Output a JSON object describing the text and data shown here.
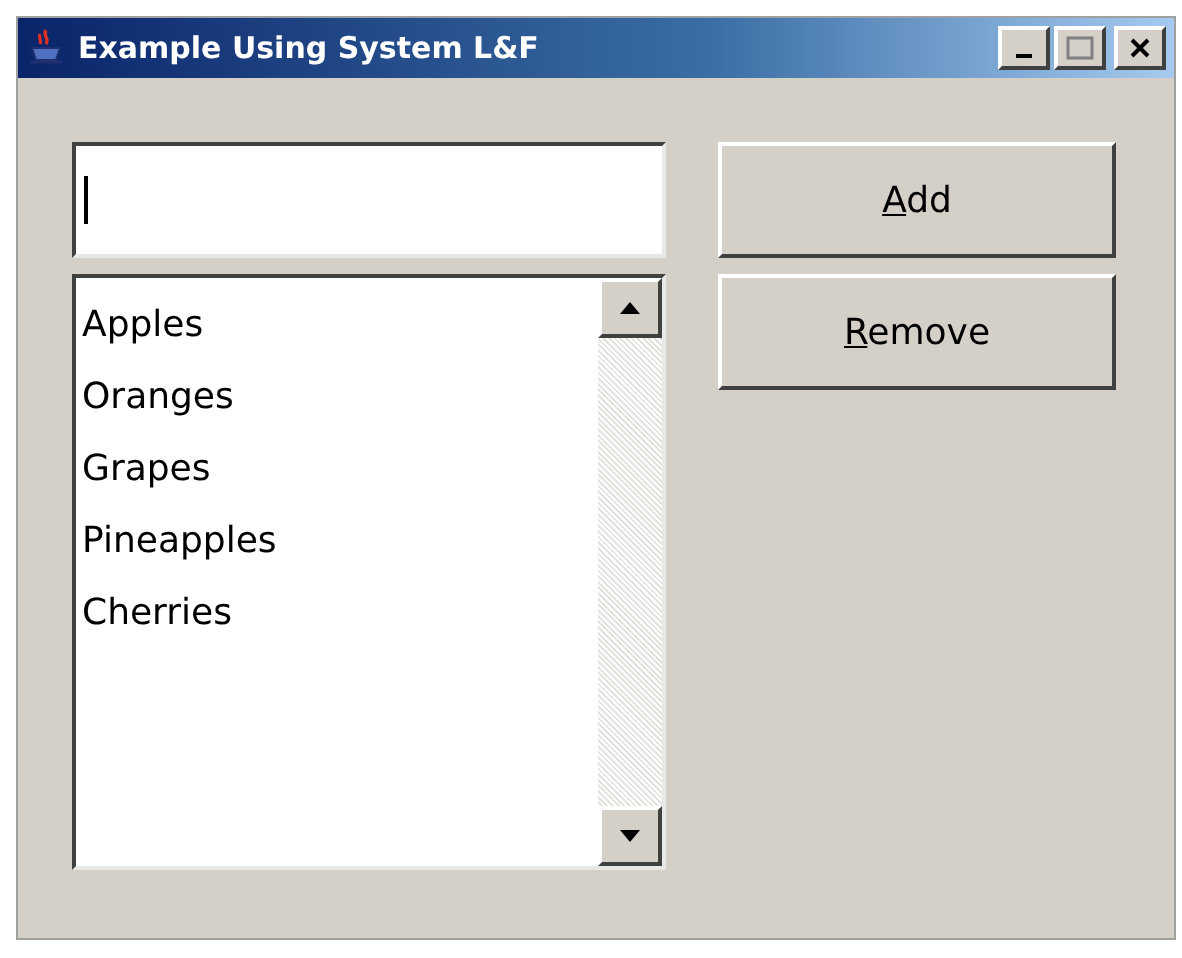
{
  "window": {
    "title": "Example Using System L&F"
  },
  "list": {
    "items": [
      {
        "label": "Apples",
        "selected": false
      },
      {
        "label": "Oranges",
        "selected": false
      },
      {
        "label": "Grapes",
        "selected": false
      },
      {
        "label": "Pineapples",
        "selected": false
      },
      {
        "label": "Cherries",
        "selected": false
      }
    ]
  },
  "buttons": [
    {
      "mnemonic": "A",
      "rest": "dd"
    },
    {
      "mnemonic": "R",
      "rest": "emove"
    }
  ]
}
